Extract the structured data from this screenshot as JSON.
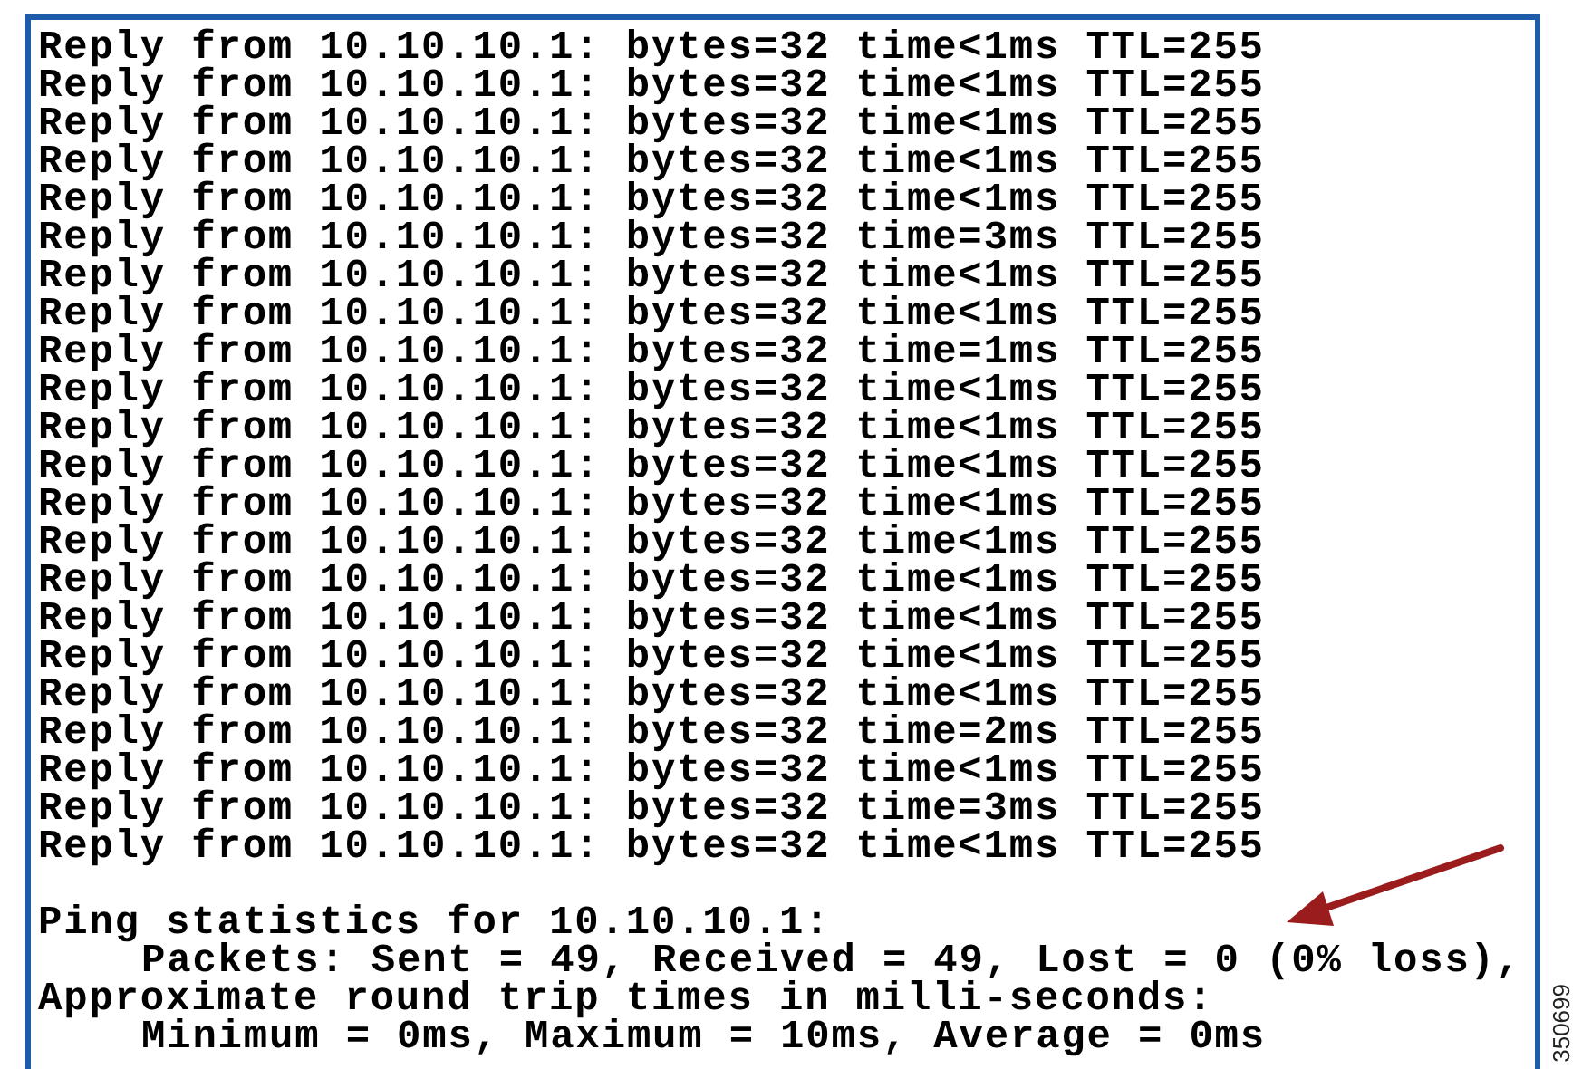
{
  "console": {
    "lines": [
      {
        "kind": "reply",
        "text": "Reply from 10.10.10.1: bytes=32 time<1ms TTL=255"
      },
      {
        "kind": "reply",
        "text": "Reply from 10.10.10.1: bytes=32 time<1ms TTL=255"
      },
      {
        "kind": "reply",
        "text": "Reply from 10.10.10.1: bytes=32 time<1ms TTL=255"
      },
      {
        "kind": "reply",
        "text": "Reply from 10.10.10.1: bytes=32 time<1ms TTL=255"
      },
      {
        "kind": "reply",
        "text": "Reply from 10.10.10.1: bytes=32 time<1ms TTL=255"
      },
      {
        "kind": "reply",
        "text": "Reply from 10.10.10.1: bytes=32 time=3ms TTL=255"
      },
      {
        "kind": "reply",
        "text": "Reply from 10.10.10.1: bytes=32 time<1ms TTL=255"
      },
      {
        "kind": "reply",
        "text": "Reply from 10.10.10.1: bytes=32 time<1ms TTL=255"
      },
      {
        "kind": "reply",
        "text": "Reply from 10.10.10.1: bytes=32 time=1ms TTL=255"
      },
      {
        "kind": "reply",
        "text": "Reply from 10.10.10.1: bytes=32 time<1ms TTL=255"
      },
      {
        "kind": "reply",
        "text": "Reply from 10.10.10.1: bytes=32 time<1ms TTL=255"
      },
      {
        "kind": "reply",
        "text": "Reply from 10.10.10.1: bytes=32 time<1ms TTL=255"
      },
      {
        "kind": "reply",
        "text": "Reply from 10.10.10.1: bytes=32 time<1ms TTL=255"
      },
      {
        "kind": "reply",
        "text": "Reply from 10.10.10.1: bytes=32 time<1ms TTL=255"
      },
      {
        "kind": "reply",
        "text": "Reply from 10.10.10.1: bytes=32 time<1ms TTL=255"
      },
      {
        "kind": "reply",
        "text": "Reply from 10.10.10.1: bytes=32 time<1ms TTL=255"
      },
      {
        "kind": "reply",
        "text": "Reply from 10.10.10.1: bytes=32 time<1ms TTL=255"
      },
      {
        "kind": "reply",
        "text": "Reply from 10.10.10.1: bytes=32 time<1ms TTL=255"
      },
      {
        "kind": "reply",
        "text": "Reply from 10.10.10.1: bytes=32 time=2ms TTL=255"
      },
      {
        "kind": "reply",
        "text": "Reply from 10.10.10.1: bytes=32 time<1ms TTL=255"
      },
      {
        "kind": "reply",
        "text": "Reply from 10.10.10.1: bytes=32 time=3ms TTL=255"
      },
      {
        "kind": "reply",
        "text": "Reply from 10.10.10.1: bytes=32 time<1ms TTL=255"
      },
      {
        "kind": "blank"
      },
      {
        "kind": "heading",
        "text": "Ping statistics for 10.10.10.1:"
      },
      {
        "kind": "detail",
        "text": "Packets: Sent = 49, Received = 49, Lost = 0 (0% loss),"
      },
      {
        "kind": "heading",
        "text": "Approximate round trip times in milli-seconds:"
      },
      {
        "kind": "detail",
        "text": "Minimum = 0ms, Maximum = 10ms, Average = 0ms"
      }
    ]
  },
  "figure_id": "350699"
}
